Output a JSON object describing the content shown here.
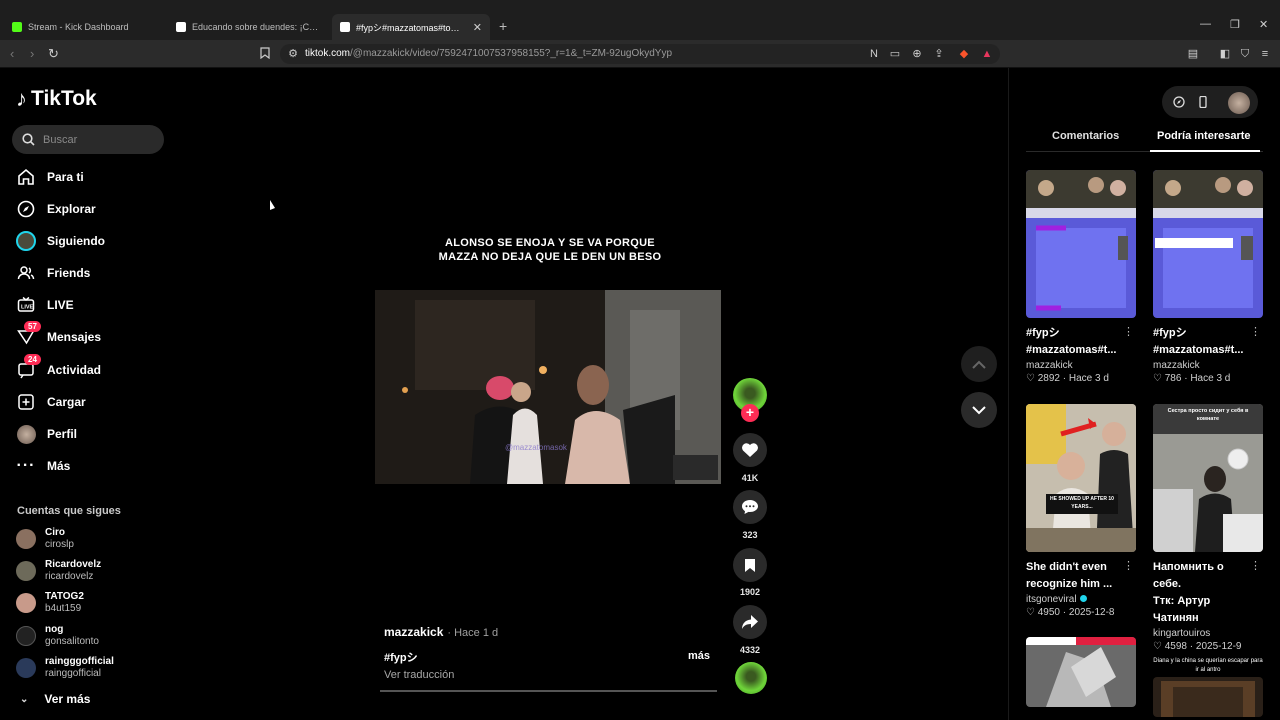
{
  "browser": {
    "tabs": [
      {
        "label": "Stream - Kick Dashboard",
        "favicon_color": "#53fc18",
        "active": false
      },
      {
        "label": "Educando sobre duendes: ¡Cuidado c",
        "favicon_color": "#ffffff",
        "active": false
      },
      {
        "label": "#fypシ#mazzatomas#tomasmaz",
        "favicon_color": "#ffffff",
        "active": true
      }
    ],
    "new_tab": "+",
    "url_site": "tiktok.com",
    "url_rest": "/@mazzakick/video/7592471007537958155?_r=1&_t=ZM-92ugOkydYyp"
  },
  "sidebar": {
    "logo": "TikTok",
    "search_placeholder": "Buscar",
    "nav": [
      {
        "label": "Para ti",
        "icon": "home-icon"
      },
      {
        "label": "Explorar",
        "icon": "compass-icon"
      },
      {
        "label": "Siguiendo",
        "icon": "following-avatar-icon"
      },
      {
        "label": "Friends",
        "icon": "friends-icon"
      },
      {
        "label": "LIVE",
        "icon": "live-icon"
      },
      {
        "label": "Mensajes",
        "icon": "messages-icon",
        "badge": "57"
      },
      {
        "label": "Actividad",
        "icon": "activity-icon",
        "badge": "24"
      },
      {
        "label": "Cargar",
        "icon": "upload-icon"
      },
      {
        "label": "Perfil",
        "icon": "profile-avatar-icon"
      },
      {
        "label": "Más",
        "icon": "more-dots-icon"
      }
    ],
    "following_title": "Cuentas que sigues",
    "following": [
      {
        "name": "Ciro",
        "username": "ciroslp",
        "avatar_color": "#8a7060"
      },
      {
        "name": "Ricardovelz",
        "username": "ricardovelz",
        "avatar_color": "#6d6a5a"
      },
      {
        "name": "TATOG2",
        "username": "b4ut159",
        "avatar_color": "#c89a8a"
      },
      {
        "name": "nog",
        "username": "gonsalitonto",
        "avatar_color": "#222222"
      },
      {
        "name": "raingggofficial",
        "username": "rainggofficial",
        "avatar_color": "#2a3a5a"
      }
    ],
    "see_more": "Ver más"
  },
  "video": {
    "caption_line1": "ALONSO SE ENOJA Y SE VA PORQUE",
    "caption_line2": "MAZZA NO DEJA QUE LE DEN UN BESO",
    "watermark": "@mazzatomasok",
    "author": "mazzakick",
    "time": "· Hace 1 d",
    "hashtag": "#fypシ",
    "more": "más",
    "translate": "Ver traducción",
    "progress": 0.0
  },
  "actions": {
    "likes": "41K",
    "comments": "323",
    "saves": "1902",
    "shares": "4332"
  },
  "right_panel": {
    "tabs": [
      "Comentarios",
      "Podría interesarte"
    ],
    "active_tab": 1,
    "cards": [
      {
        "title_line1": "#fypシ",
        "title_line2": "#mazzatomas#t...",
        "author": "mazzakick",
        "verified": false,
        "likes": "2892",
        "date": "Hace 3 d",
        "thumb_style": "purple"
      },
      {
        "title_line1": "#fypシ",
        "title_line2": "#mazzatomas#t...",
        "author": "mazzakick",
        "verified": false,
        "likes": "786",
        "date": "Hace 3 d",
        "thumb_style": "purple2"
      },
      {
        "title_line1": "She didn't even",
        "title_line2": "recognize him ...",
        "author": "itsgoneviral",
        "verified": true,
        "likes": "4950",
        "date": "2025-12-8",
        "thumb_style": "party",
        "overlay": "HE SHOWED UP AFTER 10 YEARS..."
      },
      {
        "title_line1": "Напомнить о себе.",
        "title_line2": "Ттк: Артур Чатинян",
        "author": "kingartouiros",
        "verified": false,
        "likes": "4598",
        "date": "2025-12-9",
        "thumb_style": "office",
        "overlay": "Сестра просто сидит у себя в комнате"
      },
      {
        "thumb_style": "blur"
      },
      {
        "thumb_style": "doorway",
        "overlay": "Diana y la china se querían escapar para ir al antro"
      }
    ]
  },
  "colors": {
    "accent": "#fe2c55",
    "verified": "#20d5ec",
    "background": "#000000"
  }
}
